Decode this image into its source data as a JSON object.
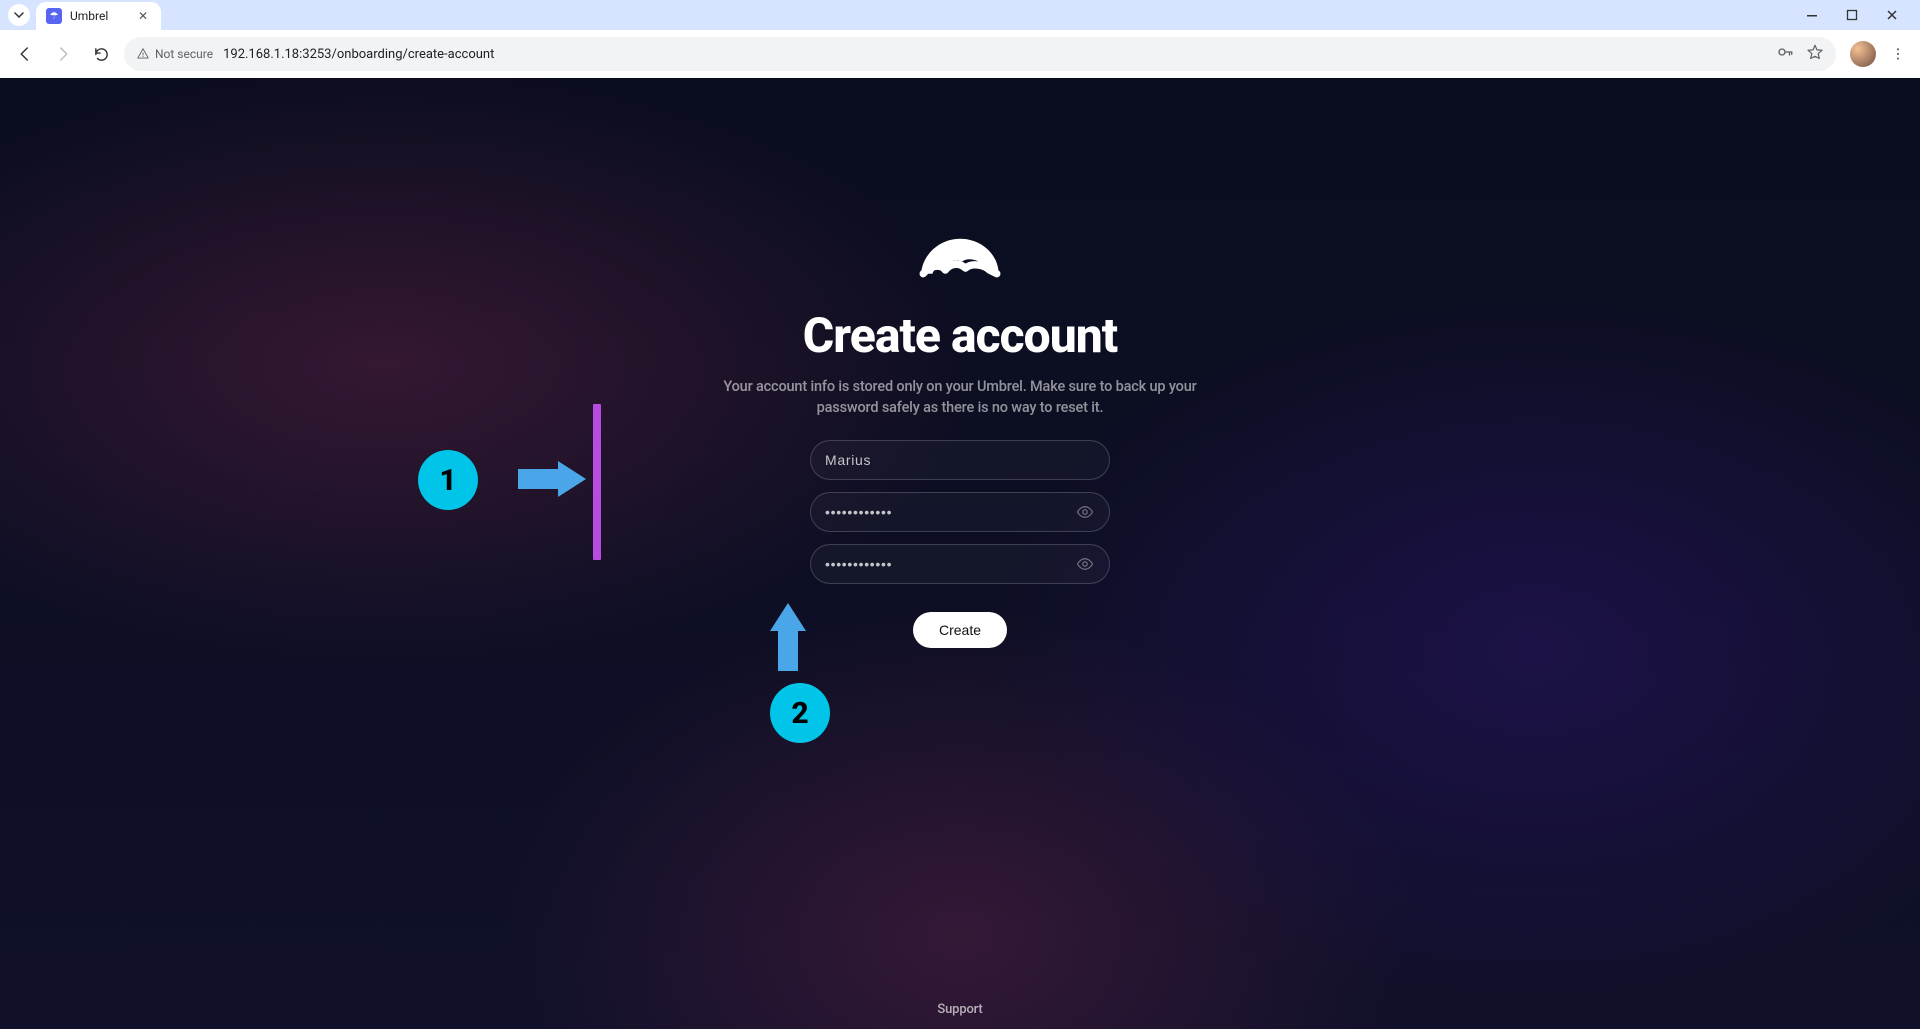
{
  "browser": {
    "tab_title": "Umbrel",
    "security_label": "Not secure",
    "url_display": "192.168.1.18:3253/onboarding/create-account"
  },
  "page": {
    "heading": "Create account",
    "subtext": "Your account info is stored only on your Umbrel. Make sure to back up your password safely as there is no way to reset it.",
    "name_value": "Marius",
    "password_value": "••••••••••••",
    "confirm_value": "••••••••••••",
    "create_label": "Create",
    "support_label": "Support"
  },
  "annotations": {
    "badge1": "1",
    "badge2": "2"
  }
}
